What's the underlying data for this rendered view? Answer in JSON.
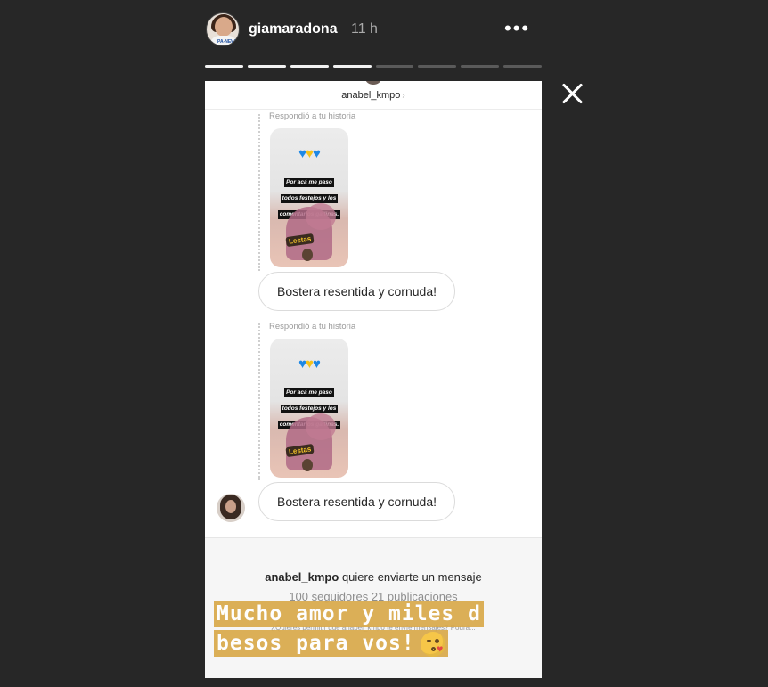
{
  "header": {
    "username": "giamaradona",
    "time": "11 h",
    "more_glyph": "•••",
    "avatar_logo": "PA-NEW"
  },
  "progress": {
    "total_segments": 8,
    "completed_segments": 4
  },
  "dm": {
    "title": "anabel_kmpo",
    "chevron": "›",
    "messages": [
      {
        "replied_label": "Respondió a tu historia",
        "story_text": [
          "Por acá me paso",
          "todos festejos y los",
          "comentarios gallinas."
        ],
        "sticker": "Lestas",
        "bubble": "Bostera resentida y cornuda!"
      },
      {
        "replied_label": "Respondió a tu historia",
        "story_text": [
          "Por acá me paso",
          "todos festejos y los",
          "comentarios gallinas."
        ],
        "sticker": "Lestas",
        "bubble": "Bostera resentida y cornuda!"
      }
    ]
  },
  "request": {
    "user": "anabel_kmpo",
    "title_rest": " quiere enviarte un mensaje",
    "stats": "100 seguidores 21 publicaciones",
    "small": "¿Quieres permitir que anabel_kmpo te envíe mensajes? Podrá..."
  },
  "caption": {
    "line1": "Mucho amor y miles d",
    "line2": "besos para vos!",
    "emoji": "face-blowing-kiss-icon"
  },
  "colors": {
    "background": "#272727",
    "caption_bg": "#d9a94a",
    "heart_blue": "#1e88e5",
    "heart_yellow": "#f6c31b"
  }
}
